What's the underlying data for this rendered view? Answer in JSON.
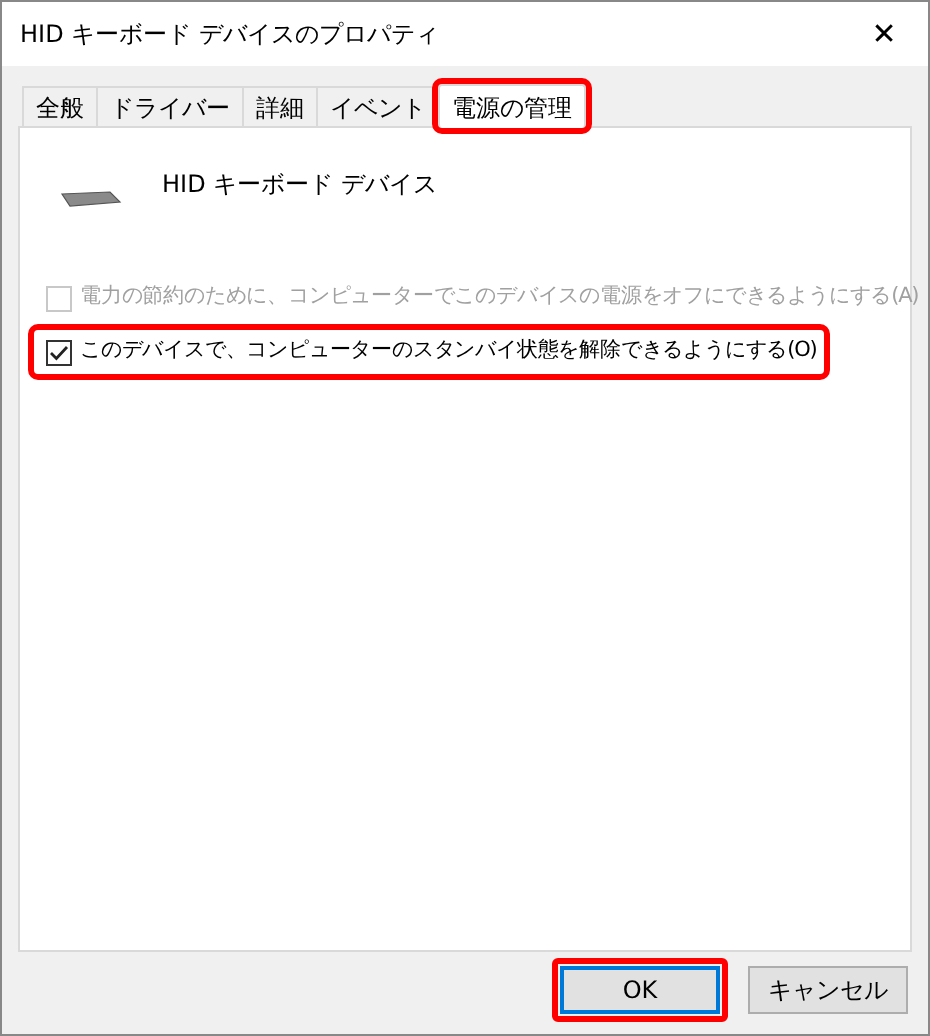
{
  "window": {
    "title": "HID キーボード デバイスのプロパティ",
    "close": "✕"
  },
  "tabs": [
    {
      "label": "全般",
      "selected": false,
      "highlighted": false
    },
    {
      "label": "ドライバー",
      "selected": false,
      "highlighted": false
    },
    {
      "label": "詳細",
      "selected": false,
      "highlighted": false
    },
    {
      "label": "イベント",
      "selected": false,
      "highlighted": false
    },
    {
      "label": "電源の管理",
      "selected": true,
      "highlighted": true
    }
  ],
  "device": {
    "name": "HID キーボード デバイス"
  },
  "options": [
    {
      "label": "電力の節約のために、コンピューターでこのデバイスの電源をオフにできるようにする(A)",
      "checked": false,
      "disabled": true,
      "highlighted": false
    },
    {
      "label": "このデバイスで、コンピューターのスタンバイ状態を解除できるようにする(O)",
      "checked": true,
      "disabled": false,
      "highlighted": true
    }
  ],
  "buttons": [
    {
      "label": "OK",
      "default": true,
      "highlighted": true
    },
    {
      "label": "キャンセル",
      "default": false,
      "highlighted": false
    }
  ]
}
